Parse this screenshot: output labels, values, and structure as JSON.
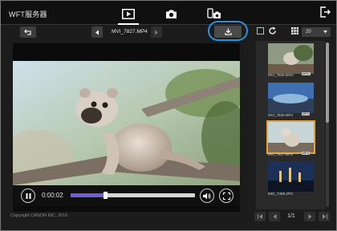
{
  "app": {
    "title": "WFT服务器"
  },
  "tabs": [
    {
      "name": "playback",
      "icon": "play-icon",
      "active": true
    },
    {
      "name": "remote-shooting",
      "icon": "camera-icon",
      "active": false
    },
    {
      "name": "camera-settings",
      "icon": "camera-settings-icon",
      "active": false
    }
  ],
  "viewer": {
    "filename": "MVI_7827.MP4",
    "time": "0:00:02",
    "progress": 0.28
  },
  "side": {
    "grid_count": "20",
    "thumbnails": [
      {
        "label": "MVI_7828.MOV",
        "badge": "MOV",
        "selected": false
      },
      {
        "label": "MVI_7830.MP4",
        "badge": "MP4",
        "selected": false
      },
      {
        "label": "MVI_7827.MP4",
        "badge": "MP4",
        "selected": true
      },
      {
        "label": "IMG_7459.JPG",
        "badge": "",
        "selected": false
      }
    ]
  },
  "pager": {
    "page": "1/1"
  },
  "footer": {
    "copyright": "Copyright CANON INC. 2016"
  },
  "colors": {
    "accent": "#2b8fe0",
    "selected": "#e6a23c",
    "seek": "#6f5fd6"
  }
}
